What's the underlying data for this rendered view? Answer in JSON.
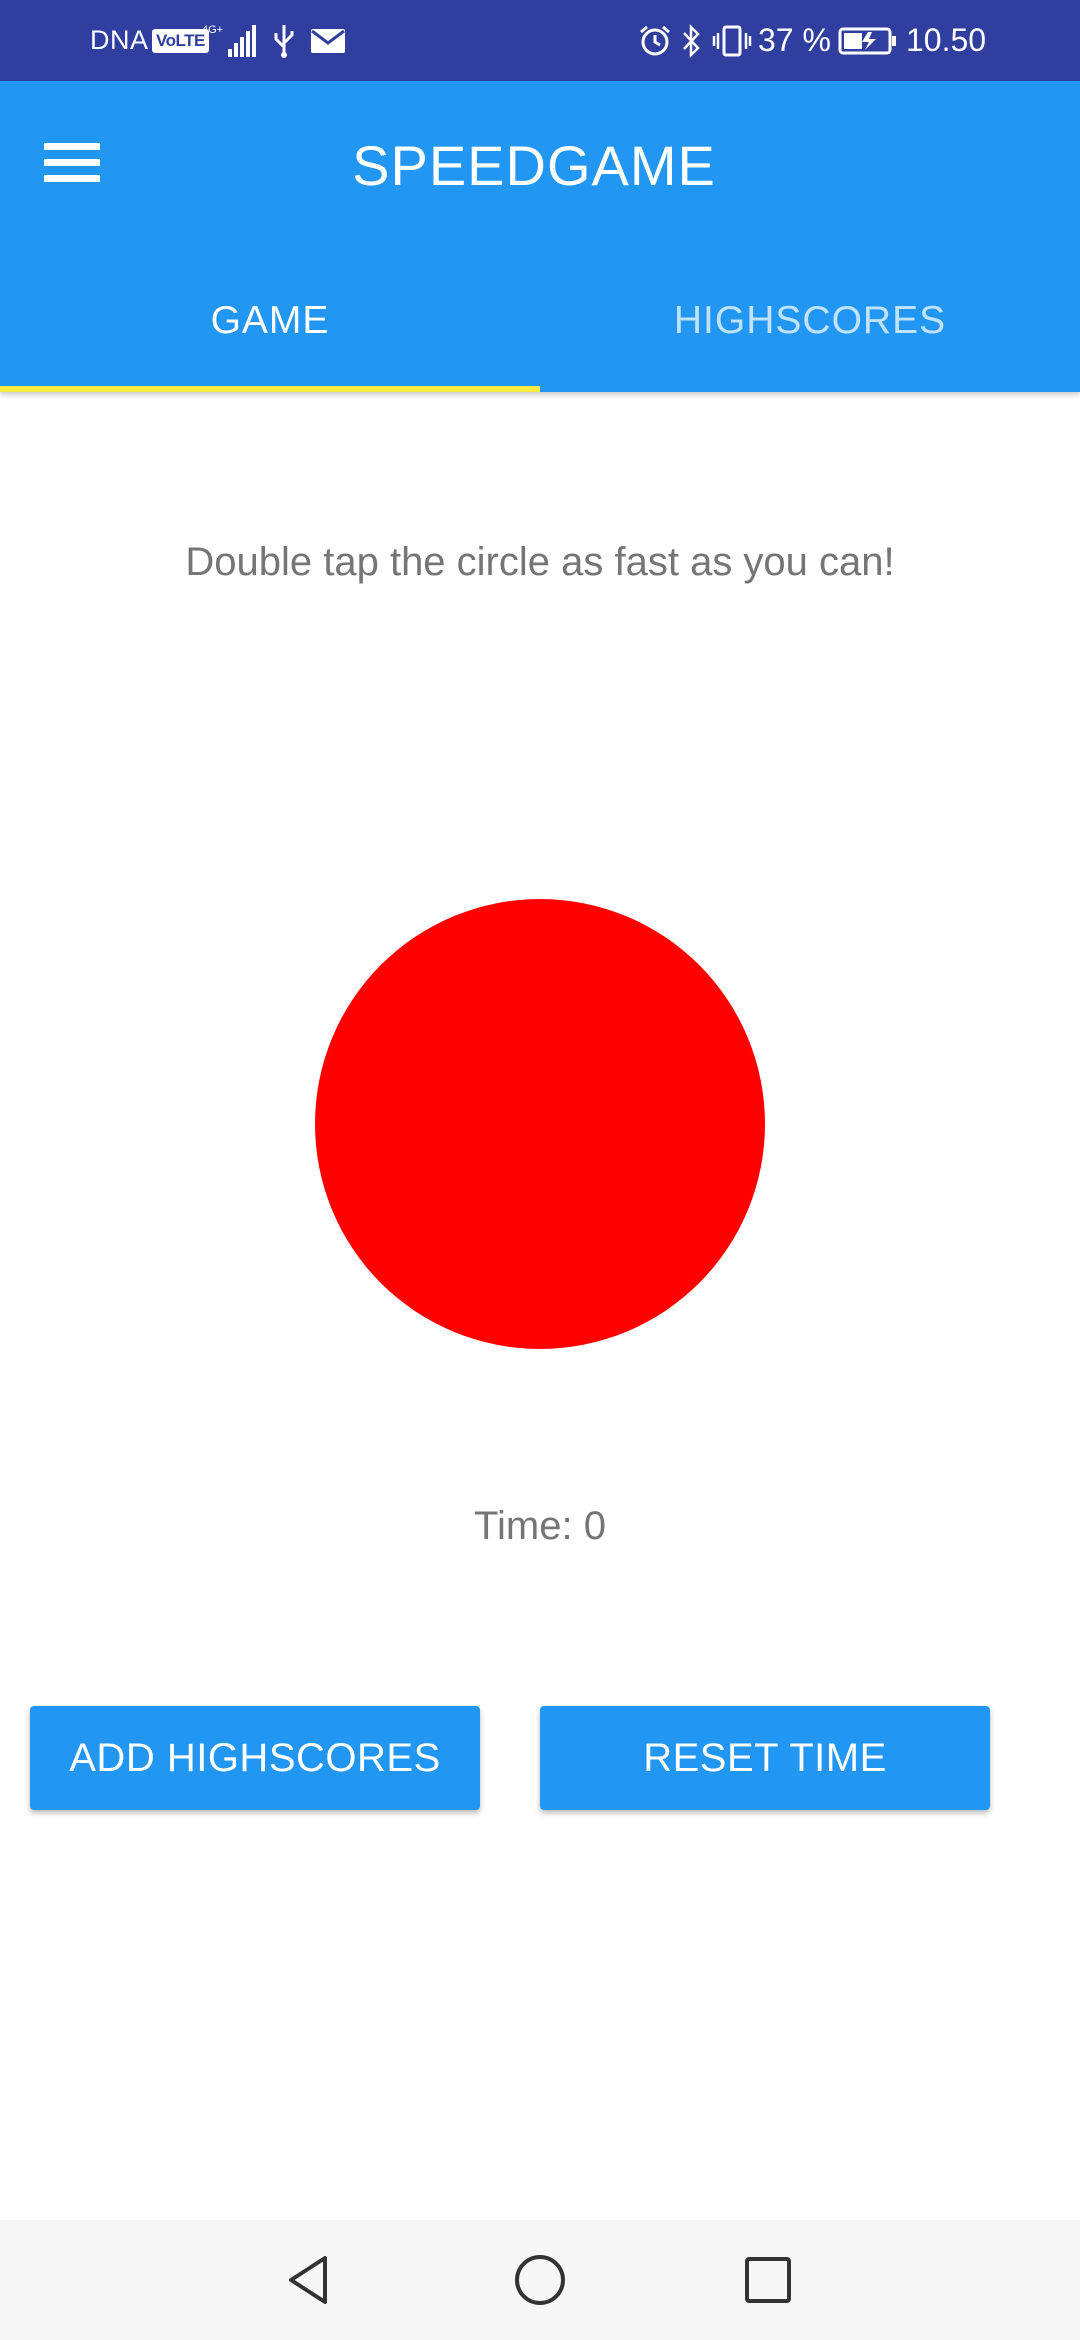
{
  "status_bar": {
    "carrier": "DNA",
    "volte": "VoLTE",
    "network": "4G+",
    "battery_percent": "37 %",
    "time": "10.50",
    "icons": [
      "volte-icon",
      "signal-icon",
      "usb-icon",
      "mail-icon",
      "alarm-icon",
      "bluetooth-icon",
      "vibrate-icon",
      "battery-charging-icon"
    ]
  },
  "app_bar": {
    "title": "SPEEDGAME",
    "menu_icon": "menu-icon",
    "color": "#2196f3"
  },
  "tabs": [
    {
      "label": "GAME",
      "active": true
    },
    {
      "label": "HIGHSCORES",
      "active": false
    }
  ],
  "tab_indicator_color": "#ffeb3b",
  "game": {
    "instructions": "Double tap the circle as fast as you can!",
    "circle_color": "#ff0000",
    "time_label": "Time: ",
    "time_value": "0"
  },
  "buttons": {
    "add_highscores": "ADD HIGHSCORES",
    "reset_time": "RESET TIME"
  },
  "navigation": {
    "icons": [
      "back-icon",
      "home-icon",
      "recent-apps-icon"
    ]
  }
}
